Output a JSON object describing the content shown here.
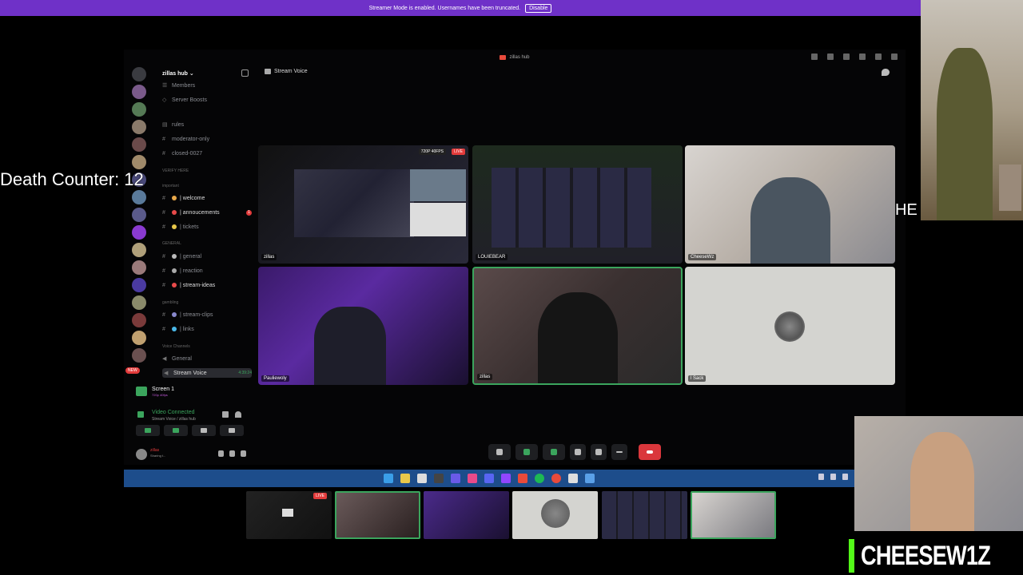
{
  "streamer_bar": {
    "message": "Streamer Mode is enabled. Usernames have been truncated.",
    "disable_label": "Disable"
  },
  "death_counter": "Death Counter: 12",
  "window": {
    "title": "zillas hub"
  },
  "server": {
    "name": "zillas hub ⌄"
  },
  "channels": [
    {
      "label": "Members",
      "type": "item"
    },
    {
      "label": "Server Boosts",
      "type": "item"
    },
    {
      "label": "rules",
      "type": "text"
    },
    {
      "label": "moderator-only",
      "type": "text"
    },
    {
      "label": "closed-0027",
      "type": "text"
    },
    {
      "label": "VERIFY HERE",
      "type": "category"
    },
    {
      "label": "important",
      "type": "category"
    },
    {
      "label": "| welcome",
      "type": "text"
    },
    {
      "label": "| annoucements",
      "type": "text",
      "mention": "1"
    },
    {
      "label": "| tickets",
      "type": "text"
    },
    {
      "label": "GENERAL",
      "type": "category"
    },
    {
      "label": "| general",
      "type": "text"
    },
    {
      "label": "| reaction",
      "type": "text"
    },
    {
      "label": "| stream-ideas",
      "type": "text"
    },
    {
      "label": "gambling",
      "type": "category"
    },
    {
      "label": "| stream-clips",
      "type": "text"
    },
    {
      "label": "| links",
      "type": "text"
    },
    {
      "label": "Voice Channels",
      "type": "category"
    },
    {
      "label": "General",
      "type": "voice"
    },
    {
      "label": "Stream Voice",
      "type": "voice",
      "active": true,
      "timer": "4:39:24"
    }
  ],
  "new_badge": "NEW",
  "voice_panel": {
    "screen_title": "Screen 1",
    "screen_sub": "720p 40fps",
    "status": "Video Connected",
    "status_sub": "Stream Voice / zillas hub",
    "user_name": "zillas",
    "user_status": "Sharing t..."
  },
  "stream_header": "Stream Voice",
  "tiles": [
    {
      "name": "zillas",
      "quality": "720P 40FPS",
      "live": "LIVE"
    },
    {
      "name": "LOUIEBEAR"
    },
    {
      "name": "CheeseWz"
    },
    {
      "name": "Pauliewoly"
    },
    {
      "name": "zillas"
    },
    {
      "name": "l Sack"
    }
  ],
  "strip_live": "LIVE",
  "he_text": "HE",
  "logo_text": "CHEESEW1Z",
  "colors": {
    "streamer_bar": "#6f31c8",
    "taskbar": "#1d4d8b",
    "accent_green": "#3ba55d",
    "leave_red": "#da373c",
    "kick_green": "#53fc18"
  }
}
